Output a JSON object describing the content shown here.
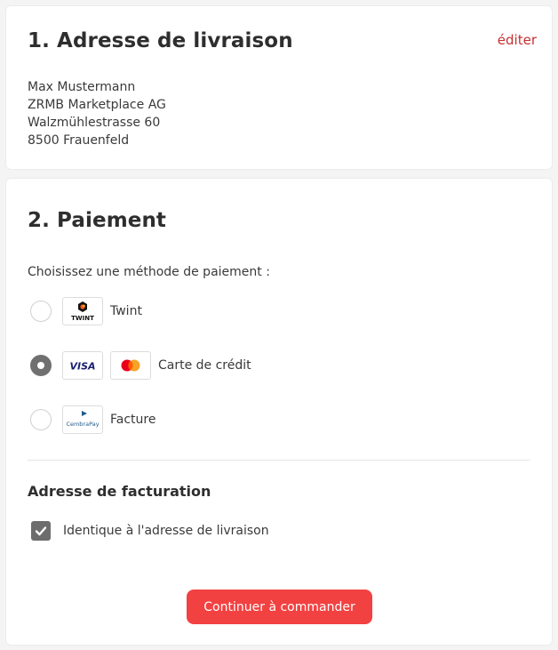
{
  "delivery": {
    "title": "1. Adresse de livraison",
    "edit_label": "éditer",
    "address_lines": [
      "Max Mustermann",
      "ZRMB Marketplace AG",
      "Walzmühlestrasse 60",
      "8500 Frauenfeld"
    ]
  },
  "payment": {
    "title": "2. Paiement",
    "choose_label": "Choisissez une méthode de paiement :",
    "options": [
      {
        "label": "Twint",
        "selected": false,
        "logos": [
          "twint-logo"
        ],
        "logo_text": [
          "TWINT"
        ]
      },
      {
        "label": "Carte de crédit",
        "selected": true,
        "logos": [
          "visa-logo",
          "mastercard-logo"
        ],
        "logo_text": [
          "VISA"
        ]
      },
      {
        "label": "Facture",
        "selected": false,
        "logos": [
          "cembrapay-logo"
        ],
        "logo_text": [
          "CembraPay"
        ]
      }
    ]
  },
  "billing": {
    "title": "Adresse de facturation",
    "same_as_delivery_label": "Identique à l'adresse de livraison",
    "same_as_delivery_checked": true
  },
  "cta": {
    "label": "Continuer à commander"
  },
  "colors": {
    "accent": "#f24141",
    "link": "#c62f2f",
    "selected_control": "#707070",
    "text": "#2d2d2d",
    "background": "#f4f4f4"
  }
}
